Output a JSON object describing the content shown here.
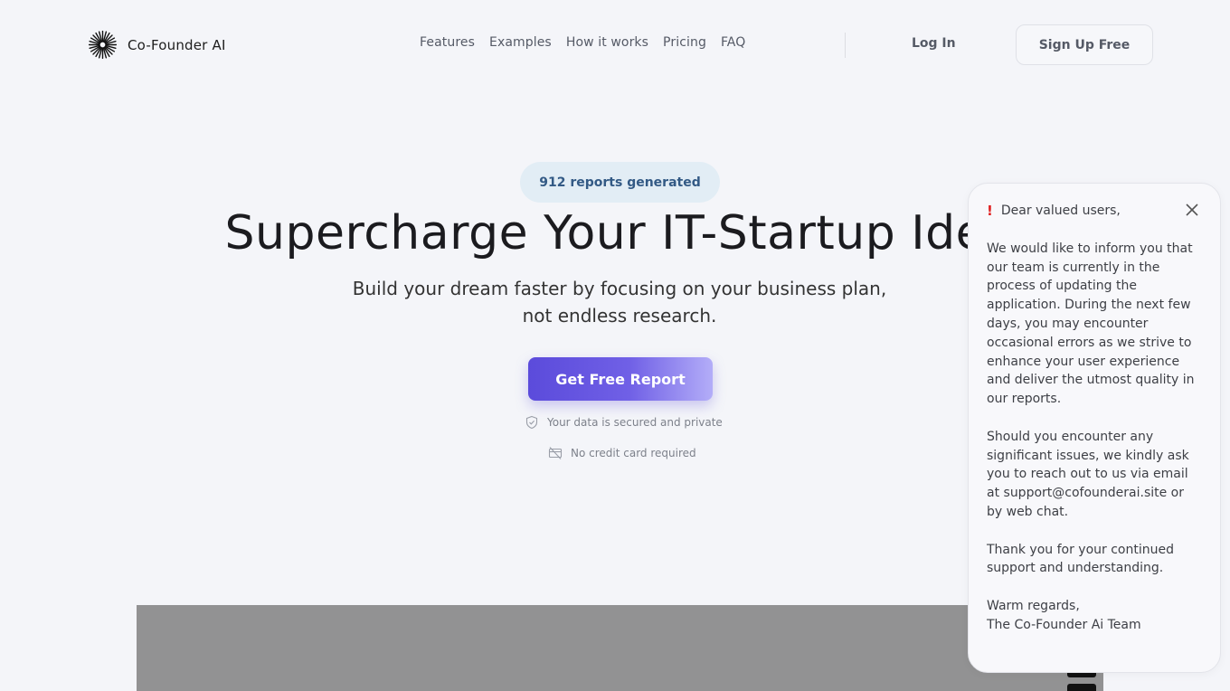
{
  "header": {
    "brand": "Co-Founder AI",
    "nav": [
      "Features",
      "Examples",
      "How it works",
      "Pricing",
      "FAQ"
    ],
    "login_label": "Log In",
    "signup_label": "Sign Up Free"
  },
  "hero": {
    "badge": "912 reports generated",
    "headline": "Supercharge Your IT-Startup Idea",
    "subline_1": "Build your dream faster by focusing on your business plan,",
    "subline_2": "not endless research.",
    "cta_label": "Get Free Report",
    "assurances": [
      {
        "icon": "shield-check-icon",
        "text": "Your data is secured and private"
      },
      {
        "icon": "no-credit-card-icon",
        "text": "No credit card required"
      }
    ]
  },
  "notice": {
    "alert_mark": "!",
    "greeting": "Dear valued users,",
    "paragraphs": [
      "We would like to inform you that our team is currently in the process of updating the application. During the next few days, you may encounter occasional errors as we strive to enhance your user experience and deliver the utmost quality in our reports.",
      "Should you encounter any significant issues, we kindly ask you to reach out to us via email at support@cofounderai.site or by web chat.",
      "Thank you for your continued support and understanding."
    ],
    "signoff_1": "Warm regards,",
    "signoff_2": "The Co-Founder Ai Team"
  },
  "colors": {
    "background": "#f4f5f9",
    "cta_start": "#5b4bdb",
    "cta_end": "#b3adf8",
    "badge_bg": "#e2edf5",
    "badge_text": "#335a85",
    "alert": "#e02020"
  }
}
